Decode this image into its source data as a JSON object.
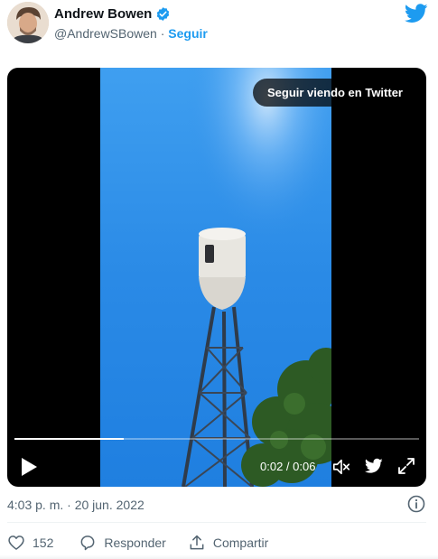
{
  "author": {
    "name": "Andrew Bowen",
    "handle": "@AndrewSBowen",
    "separator": " · ",
    "follow_label": "Seguir",
    "verified": true
  },
  "video": {
    "watch_on_twitter_label": "Seguir viendo en Twitter",
    "elapsed": "0:02",
    "time_separator": " / ",
    "duration": "0:06",
    "progress_fraction": 0.27
  },
  "tweet_meta": {
    "timestamp": "4:03 p. m. · 20 jun. 2022"
  },
  "actions": {
    "like_count": "152",
    "reply_label": "Responder",
    "share_label": "Compartir"
  },
  "colors": {
    "accent": "#1d9bf0",
    "muted_text": "#536471",
    "sky": "#2d8fe8"
  }
}
